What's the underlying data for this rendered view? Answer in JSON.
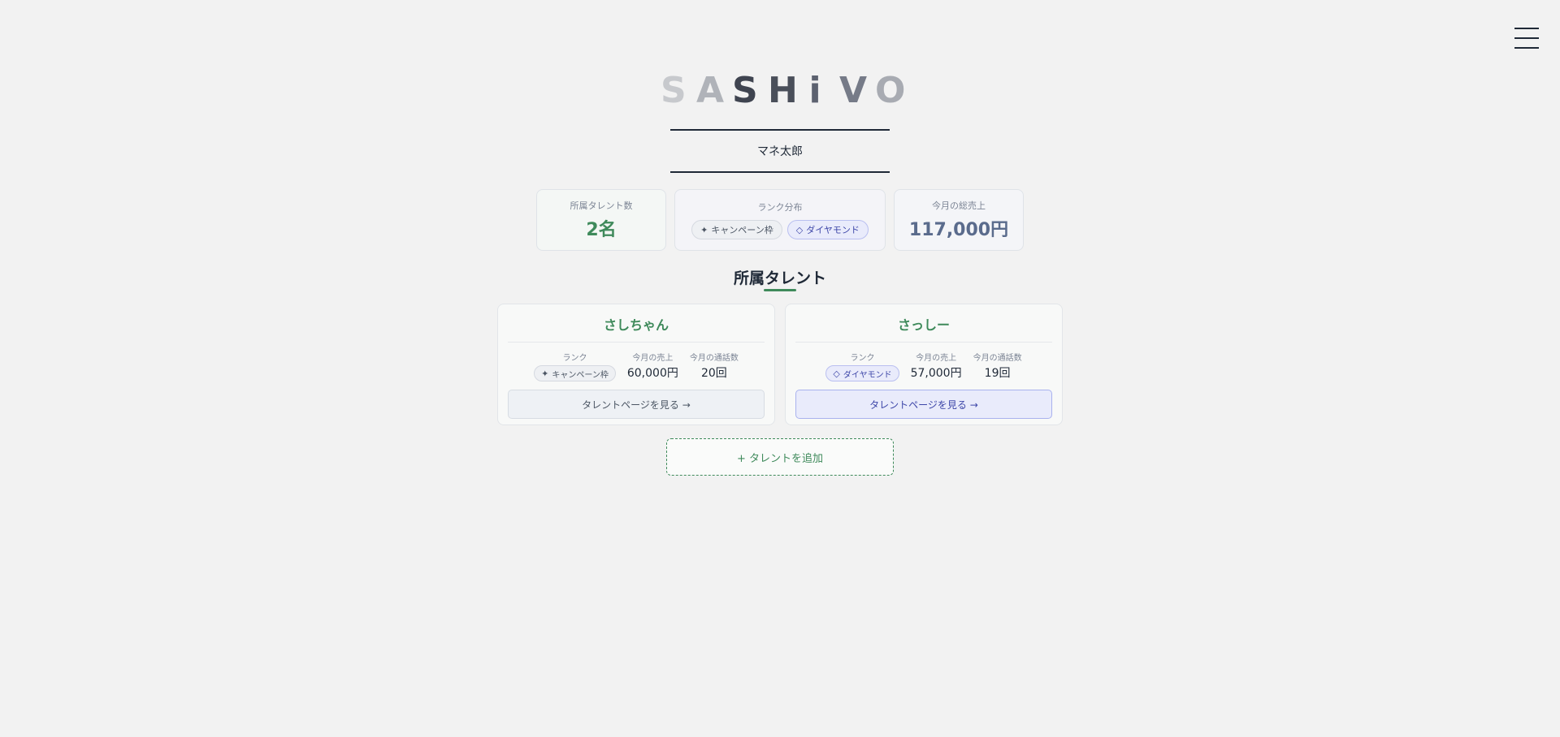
{
  "logo": {
    "letters": [
      "S",
      "A",
      "S",
      "H",
      "i",
      "V",
      "O"
    ],
    "colors": [
      "#c7c9cd",
      "#b0b3b9",
      "#3f4450",
      "#4a4f5a",
      "#5d6270",
      "#767b88",
      "#a8abb2"
    ]
  },
  "header": {
    "agency_name": "マネ太郎",
    "menu_icon": "hamburger-icon"
  },
  "stats": {
    "talent_count_label": "所属タレント数",
    "talent_count_value": "2名",
    "rank_dist_label": "ランク分布",
    "rank_badges": [
      {
        "label": "キャンペーン枠",
        "icon": "sparkle-icon"
      },
      {
        "label": "ダイヤモンド",
        "icon": "diamond-icon"
      }
    ],
    "sales_label": "今月の総売上",
    "sales_value": "117,000円"
  },
  "section": {
    "title": "所属タレント"
  },
  "talents": [
    {
      "name": "さしちゃん",
      "rank_label": "ランク",
      "rank": "キャンペーン枠",
      "rank_icon": "sparkle-icon",
      "sales_label": "今月の売上",
      "sales": "60,000円",
      "calls_label": "今月の通話数",
      "calls": "20回",
      "button": "タレントページを見る →"
    },
    {
      "name": "さっしー",
      "rank_label": "ランク",
      "rank": "ダイヤモンド",
      "rank_icon": "diamond-icon",
      "sales_label": "今月の売上",
      "sales": "57,000円",
      "calls_label": "今月の通話数",
      "calls": "19回",
      "button": "タレントページを見る →"
    }
  ],
  "add_button": "+ タレントを追加",
  "colors": {
    "accent_green": "#3f8a5b",
    "diamond_blue": "#3d46a8",
    "background": "#f2f2f2"
  }
}
